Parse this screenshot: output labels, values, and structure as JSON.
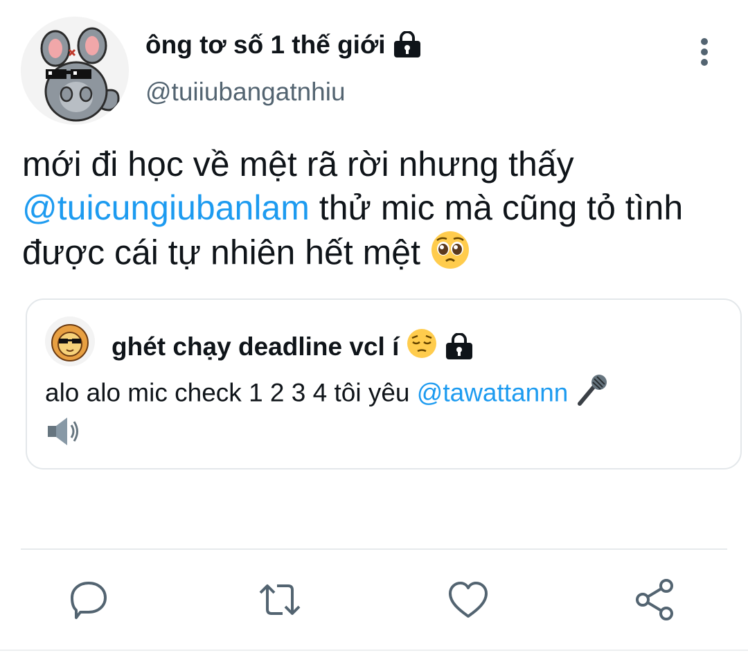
{
  "tweet": {
    "author": {
      "display_name": "ông tơ số 1 thế giới",
      "handle": "@tuiiubangatnhiu",
      "protected": true,
      "avatar": "gray-chinchilla-sunglasses-avatar"
    },
    "text": {
      "line1": "mới đi học về mệt rã rời nhưng thấy",
      "mention": "@tuicungiubanlam",
      "line2_rest": " thử mic mà cũng tỏ tình",
      "line3": "được cái tự nhiên hết mệt ",
      "emoji": "pleading-face-emoji"
    },
    "quote": {
      "author": {
        "display_name": "ghét chạy deadline vcl í",
        "name_emoji": "pensive-face-emoji",
        "protected": true,
        "avatar": "lion-sunglasses-avatar"
      },
      "text": {
        "before": "alo alo mic check 1 2 3 4 tôi yêu ",
        "mention": "@tawattannn",
        "emojis": [
          "microphone-emoji",
          "speaker-emoji"
        ]
      }
    },
    "actions": [
      "reply-icon",
      "retweet-icon",
      "like-icon",
      "share-icon"
    ]
  },
  "colors": {
    "link": "#1d9bf0",
    "secondary": "#536471",
    "text": "#0f1419",
    "border": "#e3e7ea",
    "icon": "#536471"
  }
}
